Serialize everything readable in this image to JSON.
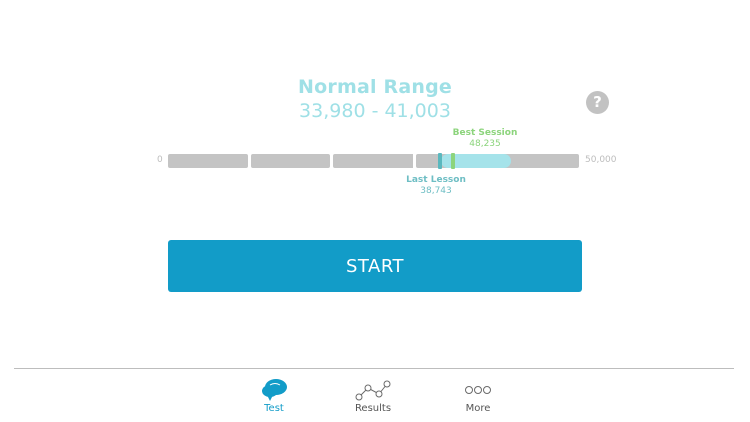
{
  "normal_range": {
    "title": "Normal Range",
    "values": "33,980 - 41,003",
    "low": 33980,
    "high": 41003
  },
  "help": {
    "label": "?"
  },
  "scale": {
    "min_label": "0",
    "max_label": "50,000",
    "min": 0,
    "max": 50000
  },
  "best_session": {
    "title": "Best Session",
    "value_label": "48,235",
    "value": 48235
  },
  "last_lesson": {
    "title": "Last Lesson",
    "value_label": "38,743",
    "value": 38743
  },
  "start_button": {
    "label": "START"
  },
  "tabs": [
    {
      "label": "Test",
      "icon": "speech-bubble-icon",
      "active": true
    },
    {
      "label": "Results",
      "icon": "line-chart-icon",
      "active": false
    },
    {
      "label": "More",
      "icon": "more-dots-icon",
      "active": false
    }
  ],
  "colors": {
    "accent": "#129cc8",
    "range": "#9fe0e6",
    "best": "#8cd47c",
    "last": "#5ab8be",
    "track": "#c4c4c4"
  }
}
